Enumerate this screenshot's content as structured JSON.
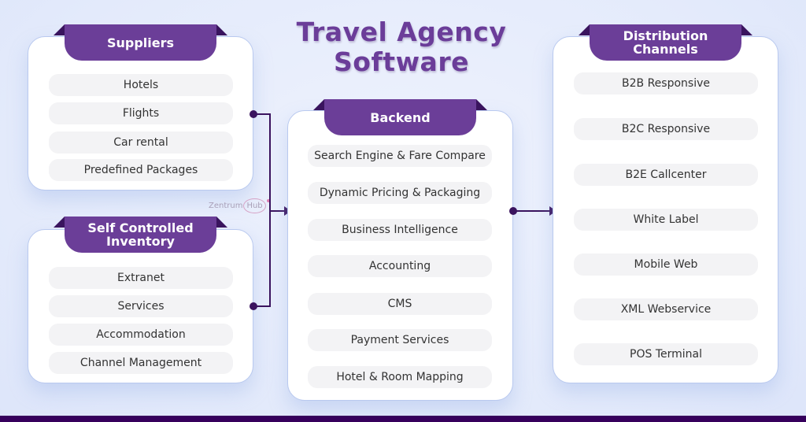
{
  "title": "Travel Agency Software",
  "title_line1": "Travel Agency",
  "title_line2": "Software",
  "logo": {
    "name": "Zentrum",
    "hub": "Hub"
  },
  "colors": {
    "accent": "#6b3e98",
    "dark": "#3a135e",
    "footer": "#36005c",
    "pill_bg": "#f3f3f5"
  },
  "suppliers": {
    "label": "Suppliers",
    "items": [
      "Hotels",
      "Flights",
      "Car rental",
      "Predefined Packages"
    ]
  },
  "inventory": {
    "label_line1": "Self Controlled",
    "label_line2": "Inventory",
    "items": [
      "Extranet",
      "Services",
      "Accommodation",
      "Channel Management"
    ]
  },
  "backend": {
    "label": "Backend",
    "items": [
      "Search Engine & Fare Compare",
      "Dynamic Pricing & Packaging",
      "Business Intelligence",
      "Accounting",
      "CMS",
      "Payment Services",
      "Hotel & Room Mapping"
    ]
  },
  "distribution": {
    "label_line1": "Distribution",
    "label_line2": "Channels",
    "items": [
      "B2B Responsive",
      "B2C Responsive",
      "B2E Callcenter",
      "White Label",
      "Mobile Web",
      "XML Webservice",
      "POS Terminal"
    ]
  }
}
